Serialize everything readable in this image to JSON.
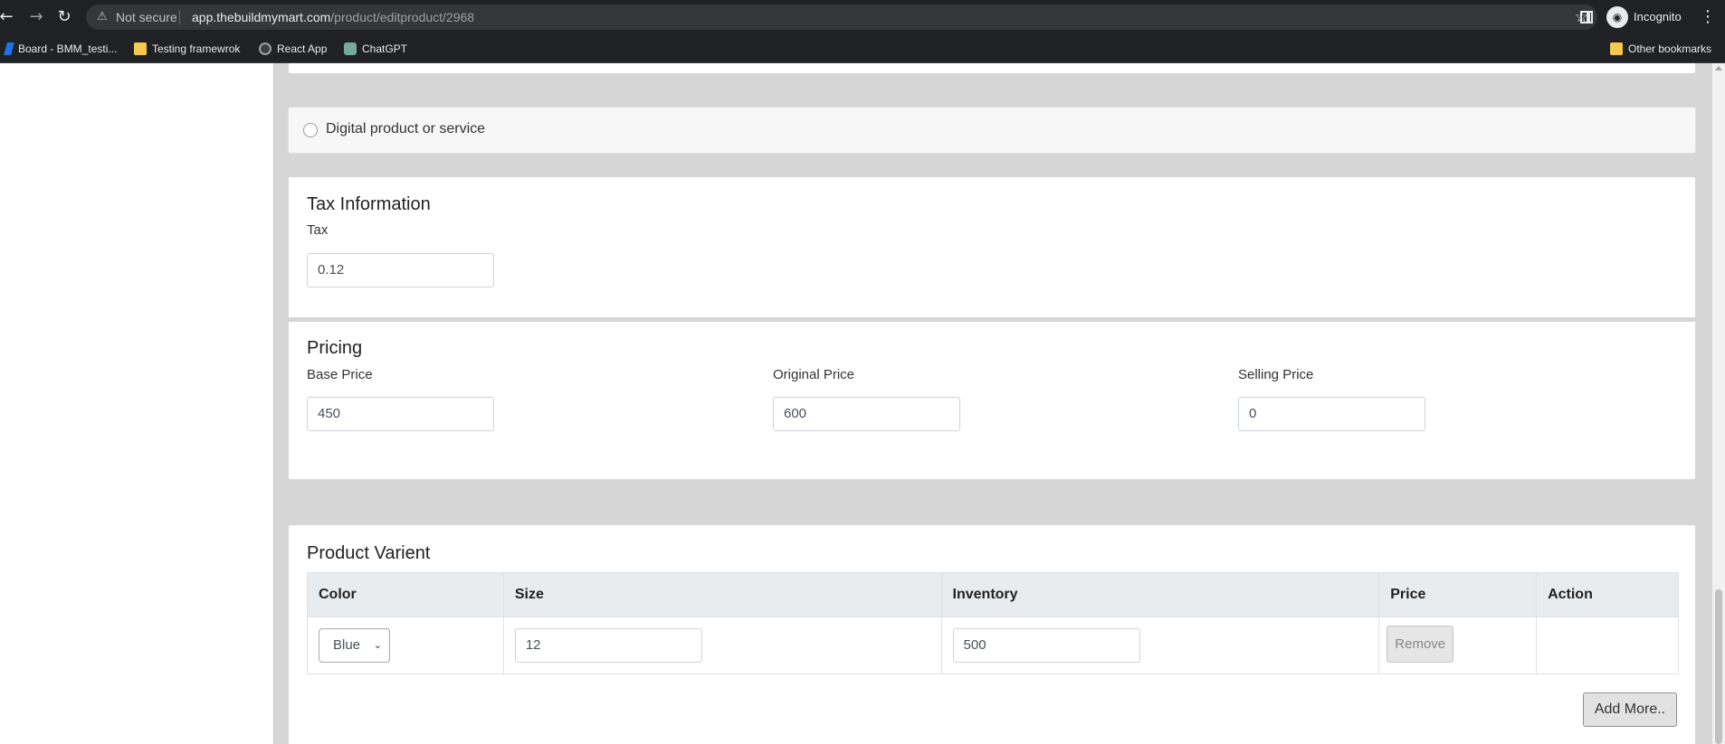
{
  "browser": {
    "security_label": "Not secure",
    "url_host": "app.thebuildmymart.com",
    "url_path": "/product/editproduct/2968",
    "profile_label": "Incognito",
    "bookmarks": [
      {
        "label": "Board - BMM_testi..."
      },
      {
        "label": "Testing framewrok"
      },
      {
        "label": "React App"
      },
      {
        "label": "ChatGPT"
      }
    ],
    "other_bookmarks_label": "Other bookmarks"
  },
  "product_type": {
    "digital_label": "Digital product or service"
  },
  "tax": {
    "title": "Tax Information",
    "tax_label": "Tax",
    "tax_value": "0.12"
  },
  "pricing": {
    "title": "Pricing",
    "base_label": "Base Price",
    "base_value": "450",
    "original_label": "Original Price",
    "original_value": "600",
    "selling_label": "Selling Price",
    "selling_value": "0"
  },
  "variant": {
    "title": "Product Varient",
    "columns": [
      "Color",
      "Size",
      "Inventory",
      "Price",
      "Action"
    ],
    "rows": [
      {
        "color": "Blue",
        "size": "12",
        "inventory": "500",
        "remove_label": "Remove"
      }
    ],
    "add_more_label": "Add More.."
  }
}
